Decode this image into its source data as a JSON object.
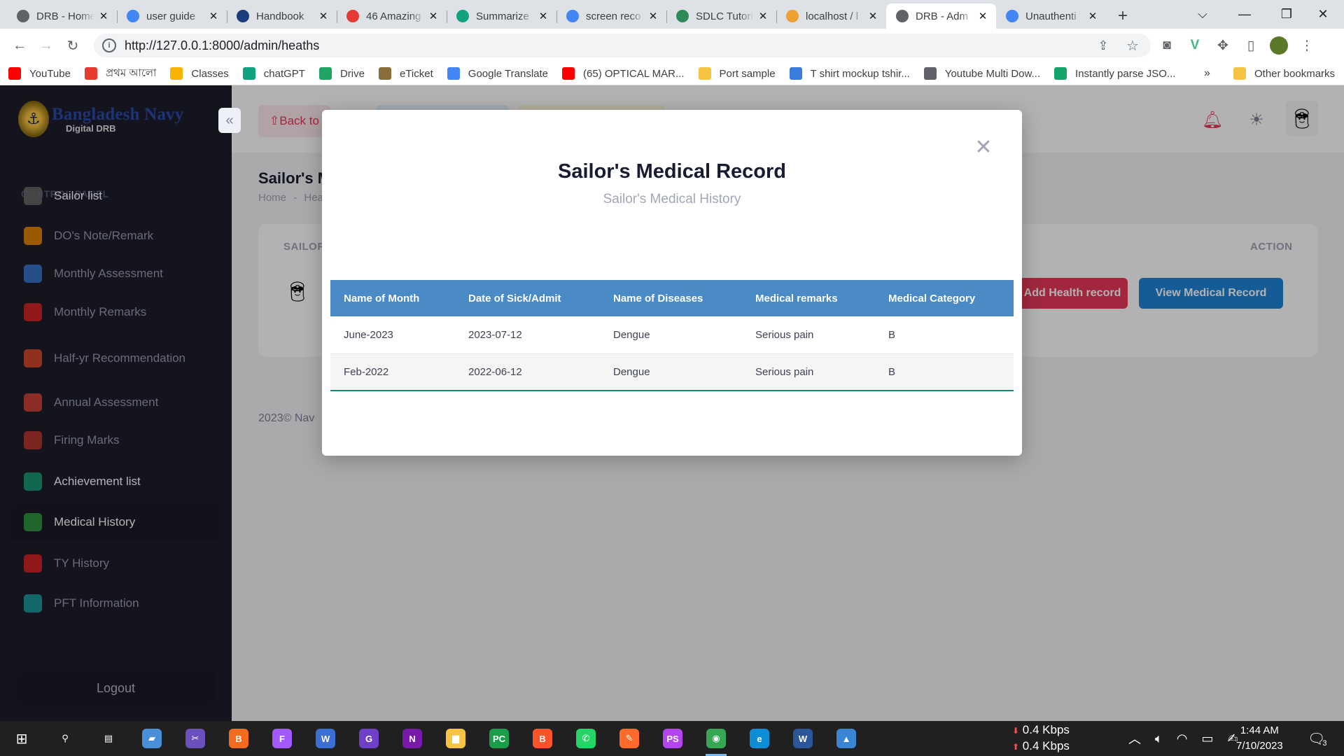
{
  "browser": {
    "tabs": [
      {
        "title": "DRB - Home",
        "favicon": "globe-icon",
        "color": "#5f6368",
        "active": false
      },
      {
        "title": "user guide",
        "favicon": "google-icon",
        "color": "#4285f4",
        "active": false
      },
      {
        "title": "Handbook",
        "favicon": "grid-icon",
        "color": "#1a3d7c",
        "active": false
      },
      {
        "title": "46 Amazing",
        "favicon": "pdf-icon",
        "color": "#e53935",
        "active": false
      },
      {
        "title": "Summarize",
        "favicon": "chatgpt-icon",
        "color": "#10a37f",
        "active": false
      },
      {
        "title": "screen reco",
        "favicon": "google-icon",
        "color": "#4285f4",
        "active": false
      },
      {
        "title": "SDLC Tutori",
        "favicon": "leaf-icon",
        "color": "#2e8b57",
        "active": false
      },
      {
        "title": "localhost / l",
        "favicon": "phpmyadmin-icon",
        "color": "#f0a030",
        "active": false
      },
      {
        "title": "DRB - Adm",
        "favicon": "globe-icon",
        "color": "#5f6368",
        "active": true
      },
      {
        "title": "Unauthenti",
        "favicon": "google-icon",
        "color": "#4285f4",
        "active": false
      }
    ],
    "url": "http://127.0.0.1:8000/admin/heaths",
    "bookmarks": [
      {
        "label": "YouTube",
        "icon": "youtube-icon",
        "color": "#ff0000"
      },
      {
        "label": "প্রথম আলো",
        "icon": "prothomalo-icon",
        "color": "#e63b2e"
      },
      {
        "label": "Classes",
        "icon": "classroom-icon",
        "color": "#f6b400"
      },
      {
        "label": "chatGPT",
        "icon": "chatgpt-icon",
        "color": "#10a37f"
      },
      {
        "label": "Drive",
        "icon": "drive-icon",
        "color": "#1fa463"
      },
      {
        "label": "eTicket",
        "icon": "eticket-icon",
        "color": "#8a6d3b"
      },
      {
        "label": "Google Translate",
        "icon": "translate-icon",
        "color": "#4285f4"
      },
      {
        "label": "(65) OPTICAL MAR...",
        "icon": "youtube-icon",
        "color": "#ff0000"
      },
      {
        "label": "Port sample",
        "icon": "folder-icon",
        "color": "#f6c343"
      },
      {
        "label": "T shirt mockup tshir...",
        "icon": "mockup-icon",
        "color": "#3b7ddd"
      },
      {
        "label": "Youtube Multi Dow...",
        "icon": "globe-icon",
        "color": "#5f6368"
      },
      {
        "label": "Instantly parse JSO...",
        "icon": "qt-icon",
        "color": "#15a56b"
      }
    ],
    "other_bookmarks": "Other bookmarks",
    "more": "»"
  },
  "sidebar": {
    "brand_title": "Bangladesh Navy",
    "brand_subtitle": "Digital DRB",
    "section": "CONTROL PANEL",
    "items": [
      {
        "label": "Sailor list",
        "icon": "sailor-icon",
        "color": "#6c6c6c"
      },
      {
        "label": "DO's Note/Remark",
        "icon": "rss-icon",
        "color": "#f28c00"
      },
      {
        "label": "Monthly Assessment",
        "icon": "calendar-chart-icon",
        "color": "#3a7bd5"
      },
      {
        "label": "Monthly Remarks",
        "icon": "command-icon",
        "color": "#e02424"
      },
      {
        "label": "Half-yr Recommendation",
        "icon": "dots-icon",
        "color": "#e04b2a"
      },
      {
        "label": "Annual Assessment",
        "icon": "calendar-31-icon",
        "color": "#d9443a"
      },
      {
        "label": "Firing Marks",
        "icon": "target-icon",
        "color": "#c0392b"
      },
      {
        "label": "Achievement list",
        "icon": "medal-icon",
        "color": "#1aa37a"
      },
      {
        "label": "Medical History",
        "icon": "medical-icon",
        "color": "#2ea043"
      },
      {
        "label": "TY History",
        "icon": "record-icon",
        "color": "#e02424"
      },
      {
        "label": "PFT Information",
        "icon": "checkbox-icon",
        "color": "#1aa3a3"
      }
    ],
    "logout": "Logout"
  },
  "header": {
    "back_label": "⇧Back to",
    "notification_icon": "bell-icon",
    "theme_icon": "sun-icon",
    "avatar_icon": "sailor-avatar-icon"
  },
  "page": {
    "title": "Sailor's M",
    "breadcrumb_home": "Home",
    "breadcrumb_sep": "-",
    "breadcrumb_current": "Hea",
    "col_sailor": "SAILOR",
    "col_action": "ACTION",
    "add_health_button": "Add Health record",
    "view_medical_button": "View Medical Record",
    "footer": "2023© Nav"
  },
  "modal": {
    "title": "Sailor's Medical Record",
    "subtitle": "Sailor's Medical History",
    "columns": [
      "Name of Month",
      "Date of Sick/Admit",
      "Name of Diseases",
      "Medical remarks",
      "Medical Category"
    ],
    "rows": [
      [
        "June-2023",
        "2023-07-12",
        "Dengue",
        "Serious pain",
        "B"
      ],
      [
        "Feb-2022",
        "2022-06-12",
        "Dengue",
        "Serious pain",
        "B"
      ]
    ]
  },
  "taskbar": {
    "apps": [
      {
        "name": "search-icon",
        "glyph": "⚲",
        "color": "#202020"
      },
      {
        "name": "taskview-icon",
        "glyph": "▤",
        "color": "#202020"
      },
      {
        "name": "app-icon",
        "glyph": "▰",
        "color": "#4a90d9"
      },
      {
        "name": "snipping-icon",
        "glyph": "✂",
        "color": "#6b4fbb"
      },
      {
        "name": "app-orange-icon",
        "glyph": "B",
        "color": "#f26b21"
      },
      {
        "name": "figma-icon",
        "glyph": "F",
        "color": "#a259ff"
      },
      {
        "name": "app-w-icon",
        "glyph": "W",
        "color": "#3b6fd4"
      },
      {
        "name": "github-icon",
        "glyph": "G",
        "color": "#6e40c9"
      },
      {
        "name": "onenote-icon",
        "glyph": "N",
        "color": "#7719aa"
      },
      {
        "name": "explorer-icon",
        "glyph": "▆",
        "color": "#f6c343"
      },
      {
        "name": "pycharm-icon",
        "glyph": "PC",
        "color": "#1b9e4a"
      },
      {
        "name": "brave-icon",
        "glyph": "B",
        "color": "#fb542b"
      },
      {
        "name": "whatsapp-icon",
        "glyph": "✆",
        "color": "#25d366"
      },
      {
        "name": "app-pen-icon",
        "glyph": "✎",
        "color": "#ff6a2b"
      },
      {
        "name": "phpstorm-icon",
        "glyph": "PS",
        "color": "#b345f1"
      },
      {
        "name": "chrome-icon",
        "glyph": "◉",
        "color": "#34a853"
      },
      {
        "name": "edge-icon",
        "glyph": "e",
        "color": "#0c8dd6"
      },
      {
        "name": "word-icon",
        "glyph": "W",
        "color": "#2b579a"
      },
      {
        "name": "photos-icon",
        "glyph": "▲",
        "color": "#3a86d4"
      }
    ],
    "net_down": "0.4 Kbps",
    "net_up": "0.4 Kbps",
    "time": "1:44 AM",
    "date": "7/10/2023",
    "notification_count": "3"
  }
}
